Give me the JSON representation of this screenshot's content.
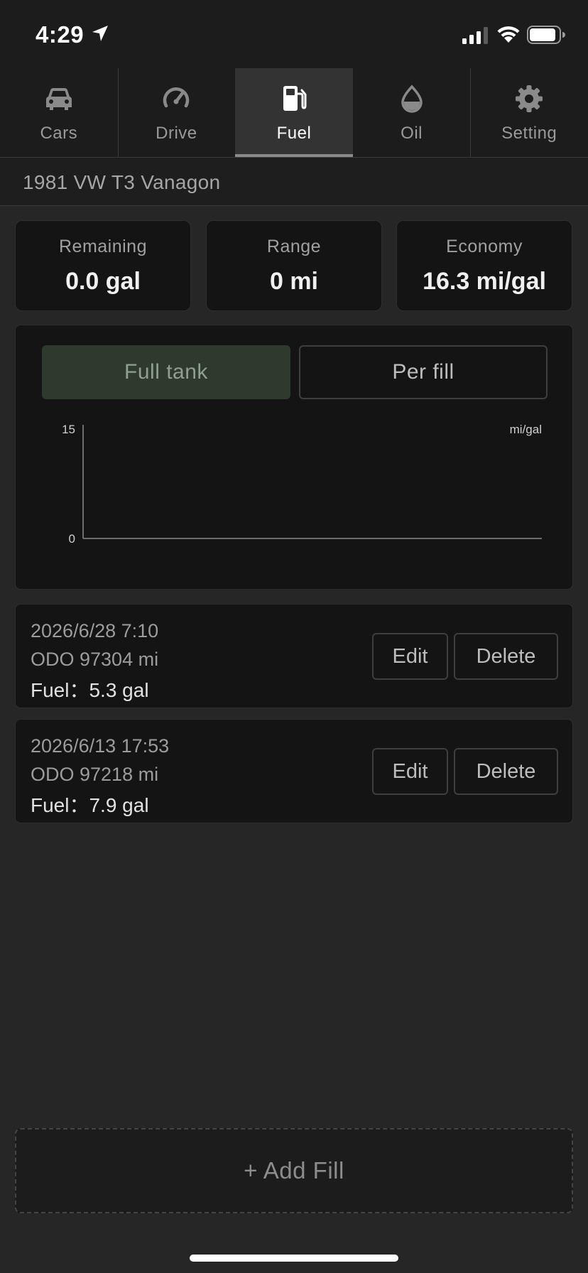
{
  "status": {
    "time": "4:29"
  },
  "tabs": [
    {
      "label": "Cars",
      "icon": "car-icon"
    },
    {
      "label": "Drive",
      "icon": "speedometer-icon"
    },
    {
      "label": "Fuel",
      "icon": "fuel-pump-icon",
      "active": true
    },
    {
      "label": "Oil",
      "icon": "oil-drop-icon"
    },
    {
      "label": "Setting",
      "icon": "gear-icon"
    }
  ],
  "car": {
    "name": "1981 VW T3 Vanagon"
  },
  "stats": {
    "remaining": {
      "label": "Remaining",
      "value": "0.0 gal"
    },
    "range": {
      "label": "Range",
      "value": "0 mi"
    },
    "economy": {
      "label": "Economy",
      "value": "16.3 mi/gal"
    }
  },
  "segments": {
    "full_tank": "Full tank",
    "per_fill": "Per fill",
    "selected": "full_tank"
  },
  "chart_data": {
    "type": "line",
    "series": [],
    "ylim": [
      0,
      15
    ],
    "yticks": [
      "15",
      "0"
    ],
    "unit": "mi/gal",
    "grid": false
  },
  "fills": [
    {
      "date": "2026/6/28 7:10",
      "odo": "ODO 97304 mi",
      "fuel": "Fuel：5.3 gal",
      "edit": "Edit",
      "delete": "Delete"
    },
    {
      "date": "2026/6/13 17:53",
      "odo": "ODO 97218 mi",
      "fuel": "Fuel：7.9 gal",
      "edit": "Edit",
      "delete": "Delete"
    }
  ],
  "add_fill": "+ Add Fill",
  "colors": {
    "background": "#262626",
    "card": "#141414",
    "accent_selected": "#2d3a2d"
  }
}
